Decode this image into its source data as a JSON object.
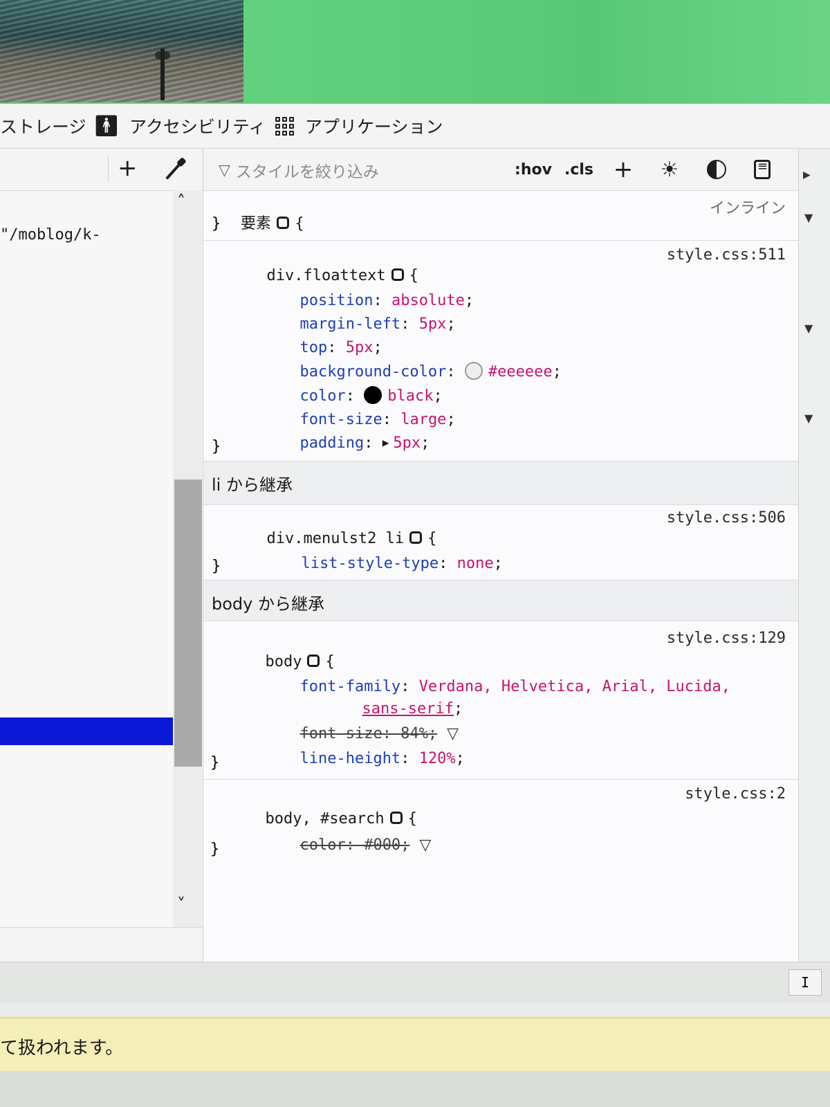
{
  "tabs": [
    {
      "label": "ストレージ"
    },
    {
      "label": "アクセシビリティ"
    },
    {
      "label": "アプリケーション"
    }
  ],
  "markup": {
    "visible_fragment": "\"/moblog/k-"
  },
  "rules_toolbar": {
    "filter_placeholder": "スタイルを絞り込み",
    "hov_label": ":hov",
    "cls_label": ".cls",
    "add_label": "+"
  },
  "rules": {
    "element": {
      "selector": "要素",
      "open": "{",
      "close": "}",
      "source": "インライン"
    },
    "floattext": {
      "selector": "div.floattext",
      "source": "style.css:511",
      "declarations": [
        {
          "prop": "position",
          "value": "absolute"
        },
        {
          "prop": "margin-left",
          "value": "5px"
        },
        {
          "prop": "top",
          "value": "5px"
        },
        {
          "prop": "background-color",
          "value": "#eeeeee"
        },
        {
          "prop": "color",
          "value": "black"
        },
        {
          "prop": "font-size",
          "value": "large"
        },
        {
          "prop": "padding",
          "value": "5px"
        }
      ]
    },
    "inherit_li": "li から継承",
    "menulst2": {
      "selector": "div.menulst2 li",
      "source": "style.css:506",
      "declarations": [
        {
          "prop": "list-style-type",
          "value": "none"
        }
      ]
    },
    "inherit_body": "body から継承",
    "body": {
      "selector": "body",
      "source": "style.css:129",
      "font_family_prop": "font-family",
      "font_family_value": "Verdana, Helvetica, Arial, Lucida,",
      "font_family_cont": "sans-serif",
      "font_size_struck": "font-size: 84%;",
      "line_height_prop": "line-height",
      "line_height_value": "120%"
    },
    "body_search": {
      "selector": "body, #search",
      "source": "style.css:2",
      "color_struck": "color: #000;"
    }
  },
  "notice": {
    "text": "て扱われます。"
  },
  "bottom_button": {
    "label": "I"
  },
  "colors": {
    "selected_row": "#0b19d6",
    "property": "#1f3fb3",
    "value": "#c8146e",
    "swatch_bg": "#eeeeee",
    "swatch_color": "#000000"
  },
  "icons": {
    "accessibility": "person-icon",
    "application": "grid-icon",
    "add": "plus-icon",
    "picker": "eyedropper-icon",
    "filter": "funnel-icon",
    "light": "sun-icon",
    "dark": "moon-icon",
    "print": "document-icon"
  }
}
